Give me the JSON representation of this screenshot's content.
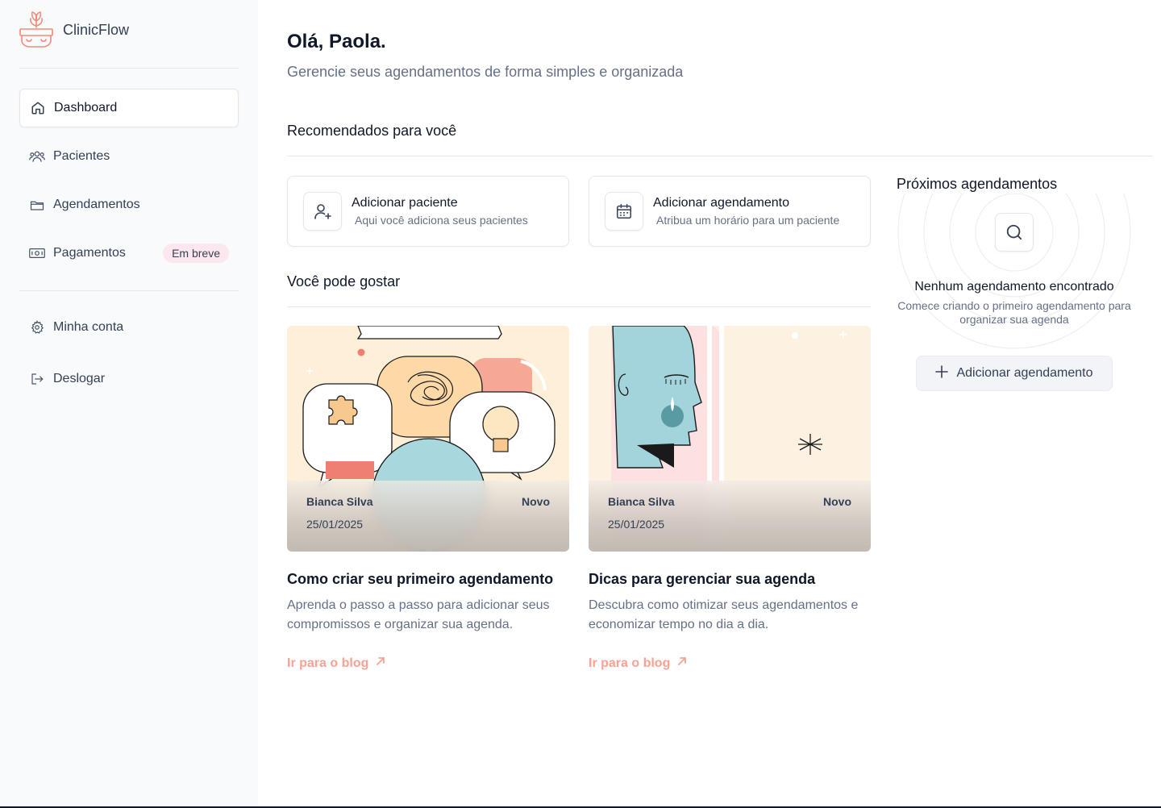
{
  "app": {
    "name": "ClinicFlow"
  },
  "sidebar": {
    "items": [
      {
        "label": "Dashboard",
        "icon": "home-icon",
        "active": true
      },
      {
        "label": "Pacientes",
        "icon": "users-icon"
      },
      {
        "label": "Agendamentos",
        "icon": "folder-icon"
      },
      {
        "label": "Pagamentos",
        "icon": "banknote-icon",
        "badge": "Em breve"
      }
    ],
    "bottom_items": [
      {
        "label": "Minha conta",
        "icon": "gear-icon"
      },
      {
        "label": "Deslogar",
        "icon": "logout-icon"
      }
    ]
  },
  "header": {
    "greeting": "Olá, Paola.",
    "subtitle": "Gerencie seus agendamentos de forma simples e organizada"
  },
  "recommended": {
    "title": "Recomendados para você",
    "cards": [
      {
        "title": "Adicionar paciente",
        "subtitle": "Aqui você adiciona seus pacientes",
        "icon": "user-plus-icon"
      },
      {
        "title": "Adicionar agendamento",
        "subtitle": "Atribua um horário para um paciente",
        "icon": "calendar-icon"
      }
    ]
  },
  "blog": {
    "title": "Você pode gostar",
    "posts": [
      {
        "author": "Bianca Silva",
        "date": "25/01/2025",
        "tag": "Novo",
        "title": "Como criar seu primeiro agendamento",
        "description": "Aprenda o passo a passo para adicionar seus compromissos e organizar sua agenda.",
        "link": "Ir para o blog"
      },
      {
        "author": "Bianca Silva",
        "date": "25/01/2025",
        "tag": "Novo",
        "title": "Dicas para gerenciar sua agenda",
        "description": "Descubra como otimizar seus agendamentos e economizar tempo no dia a dia.",
        "link": "Ir para o blog"
      }
    ]
  },
  "upcoming": {
    "title": "Próximos agendamentos",
    "empty_title": "Nenhum agendamento encontrado",
    "empty_subtitle": "Comece criando o primeiro agendamento para organizar sua agenda",
    "button": "Adicionar agendamento"
  },
  "colors": {
    "accent": "#f7a294",
    "badge_bg": "#fce7ee",
    "sidebar_bg": "#f9fafb"
  }
}
